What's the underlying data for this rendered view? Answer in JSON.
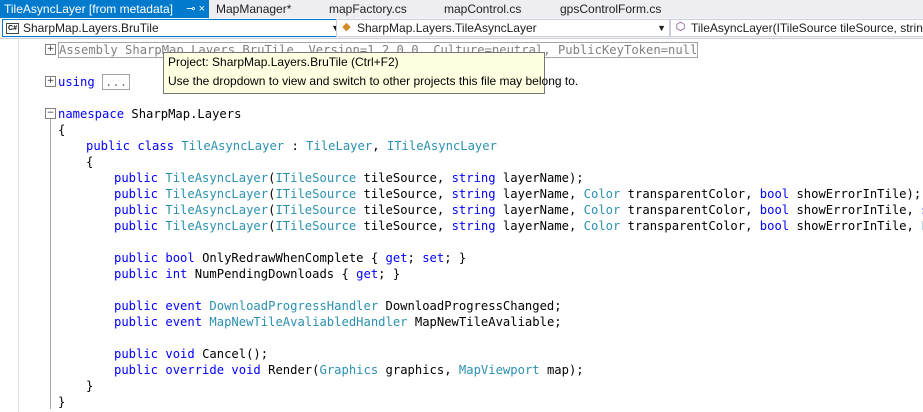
{
  "tabs": [
    {
      "label": "TileAsyncLayer [from metadata]",
      "active": true
    },
    {
      "label": "MapManager*",
      "active": false
    },
    {
      "label": "mapFactory.cs",
      "active": false
    },
    {
      "label": "mapControl.cs",
      "active": false
    },
    {
      "label": "gpsControlForm.cs",
      "active": false
    }
  ],
  "tab_icons": {
    "pin": "⊸",
    "close": "×"
  },
  "nav": {
    "project": "SharpMap.Layers.BruTile",
    "type": "SharpMap.Layers.TileAsyncLayer",
    "member": "TileAsyncLayer(ITileSource tileSource, string layerName)"
  },
  "tooltip": {
    "line1": "Project: SharpMap.Layers.BruTile (Ctrl+F2)",
    "line2": "Use the dropdown to view and switch to other projects this file may belong to."
  },
  "code": {
    "assembly": "Assembly SharpMap.Layers.BruTile, Version=1.2.0.0, Culture=neutral, PublicKeyToken=null",
    "using_kw": "using",
    "using_collapsed": "...",
    "namespace_kw": "namespace",
    "namespace_name": " SharpMap.Layers",
    "class_line": {
      "kw": "public class ",
      "name": "TileAsyncLayer",
      "colon": " : ",
      "base1": "TileLayer",
      "comma": ", ",
      "base2": "ITileAsyncLayer"
    },
    "ctors": [
      "public TileAsyncLayer(ITileSource tileSource, string layerName);",
      "public TileAsyncLayer(ITileSource tileSource, string layerName, Color transparentColor, bool showErrorInTile);",
      "public TileAsyncLayer(ITileSource tileSource, string layerName, Color transparentColor, bool showErrorInTile, string",
      "public TileAsyncLayer(ITileSource tileSource, string layerName, Color transparentColor, bool showErrorInTile, FileCa"
    ],
    "props": [
      "public bool OnlyRedrawWhenComplete { get; set; }",
      "public int NumPendingDownloads { get; }"
    ],
    "events": [
      "public event DownloadProgressHandler DownloadProgressChanged;",
      "public event MapNewTileAvaliabledHandler MapNewTileAvaliable;"
    ],
    "methods": [
      "public void Cancel();",
      "public override void Render(Graphics graphics, MapViewport map);"
    ],
    "open_brace": "{",
    "close_brace": "}"
  },
  "colors": {
    "keyword": "#0000ff",
    "type": "#2b91af",
    "accent": "#007acc"
  }
}
